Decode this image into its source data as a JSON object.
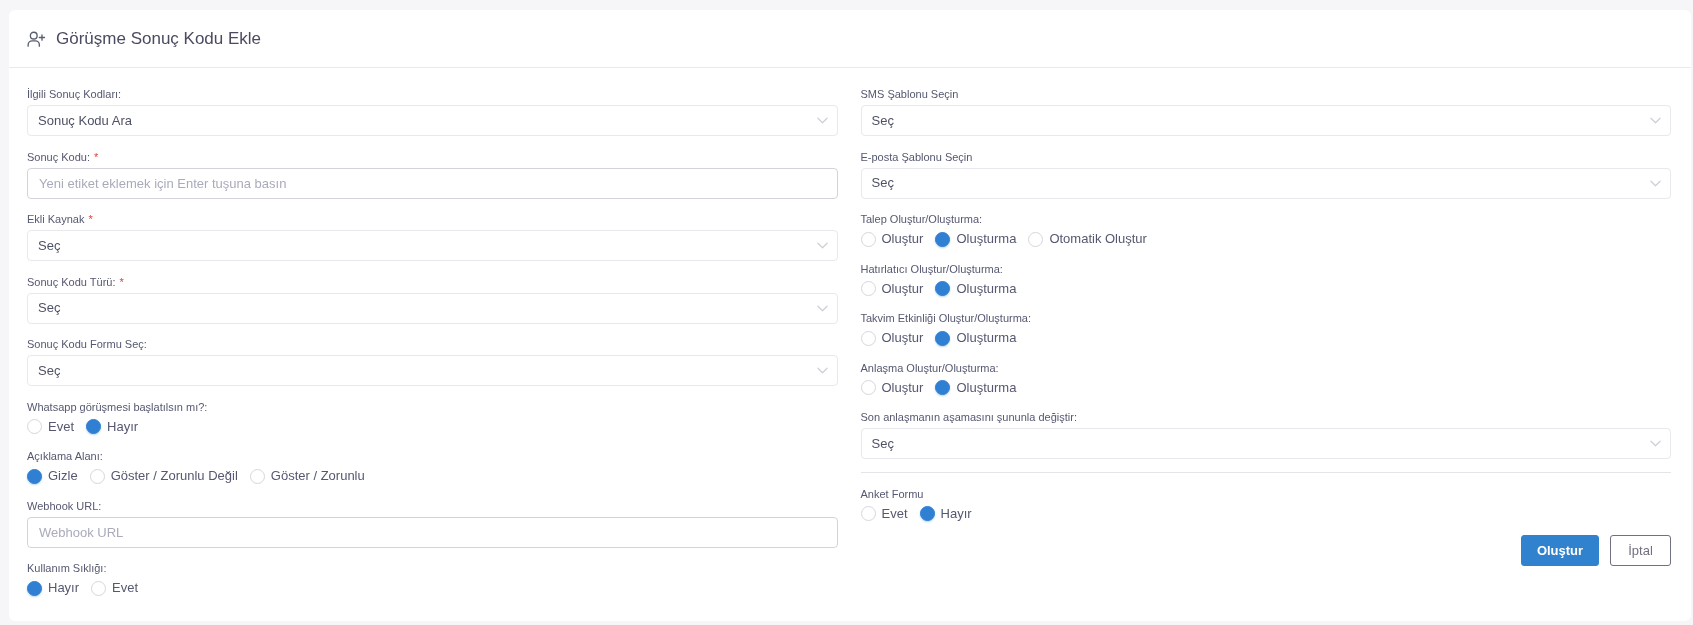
{
  "header": {
    "title": "Görüşme Sonuç Kodu Ekle"
  },
  "columns": [
    {
      "fields": [
        {
          "kind": "select",
          "label": "İlgili Sonuç Kodları:",
          "value": "Sonuç Kodu Ara"
        },
        {
          "kind": "text",
          "label": "Sonuç Kodu:",
          "required_mark": "*",
          "placeholder": "Yeni etiket eklemek için Enter tuşuna basın"
        },
        {
          "kind": "select",
          "label": "Ekli Kaynak",
          "required_mark": "*",
          "value": "Seç"
        },
        {
          "kind": "select",
          "label": "Sonuç Kodu Türü:",
          "required_mark": "*",
          "value": "Seç"
        },
        {
          "kind": "select",
          "label": "Sonuç Kodu Formu Seç:",
          "value": "Seç"
        },
        {
          "kind": "radio",
          "label": "Whatsapp görüşmesi başlatılsın mı?:",
          "options": [
            {
              "label": "Evet",
              "selected": false
            },
            {
              "label": "Hayır",
              "selected": true
            }
          ]
        },
        {
          "kind": "radio",
          "label": "Açıklama Alanı:",
          "options": [
            {
              "label": "Gizle",
              "selected": true
            },
            {
              "label": "Göster / Zorunlu Değil",
              "selected": false
            },
            {
              "label": "Göster / Zorunlu",
              "selected": false
            }
          ]
        },
        {
          "kind": "text",
          "label": "Webhook URL:",
          "placeholder": "Webhook URL"
        },
        {
          "kind": "radio",
          "label": "Kullanım Sıklığı:",
          "options": [
            {
              "label": "Hayır",
              "selected": true
            },
            {
              "label": "Evet",
              "selected": false
            }
          ]
        }
      ]
    },
    {
      "fields": [
        {
          "kind": "select",
          "label": "SMS Şablonu Seçin",
          "value": "Seç"
        },
        {
          "kind": "select",
          "label": "E-posta Şablonu Seçin",
          "value": "Seç"
        },
        {
          "kind": "radio",
          "label": "Talep Oluştur/Oluşturma:",
          "options": [
            {
              "label": "Oluştur",
              "selected": false
            },
            {
              "label": "Oluşturma",
              "selected": true
            },
            {
              "label": "Otomatik Oluştur",
              "selected": false
            }
          ]
        },
        {
          "kind": "radio",
          "label": "Hatırlatıcı Oluştur/Oluşturma:",
          "options": [
            {
              "label": "Oluştur",
              "selected": false
            },
            {
              "label": "Oluşturma",
              "selected": true
            }
          ]
        },
        {
          "kind": "radio",
          "label": "Takvim Etkinliği Oluştur/Oluşturma:",
          "options": [
            {
              "label": "Oluştur",
              "selected": false
            },
            {
              "label": "Oluşturma",
              "selected": true
            }
          ]
        },
        {
          "kind": "radio",
          "label": "Anlaşma Oluştur/Oluşturma:",
          "options": [
            {
              "label": "Oluştur",
              "selected": false
            },
            {
              "label": "Oluşturma",
              "selected": true
            }
          ]
        },
        {
          "kind": "select",
          "label": "Son anlaşmanın aşamasını şununla değiştir:",
          "value": "Seç"
        },
        {
          "kind": "divider"
        },
        {
          "kind": "radio",
          "label": "Anket Formu",
          "options": [
            {
              "label": "Evet",
              "selected": false
            },
            {
              "label": "Hayır",
              "selected": true
            }
          ]
        }
      ],
      "buttons": [
        {
          "label": "Oluştur",
          "kind": "primary"
        },
        {
          "label": "İptal",
          "kind": "outline"
        }
      ]
    }
  ]
}
